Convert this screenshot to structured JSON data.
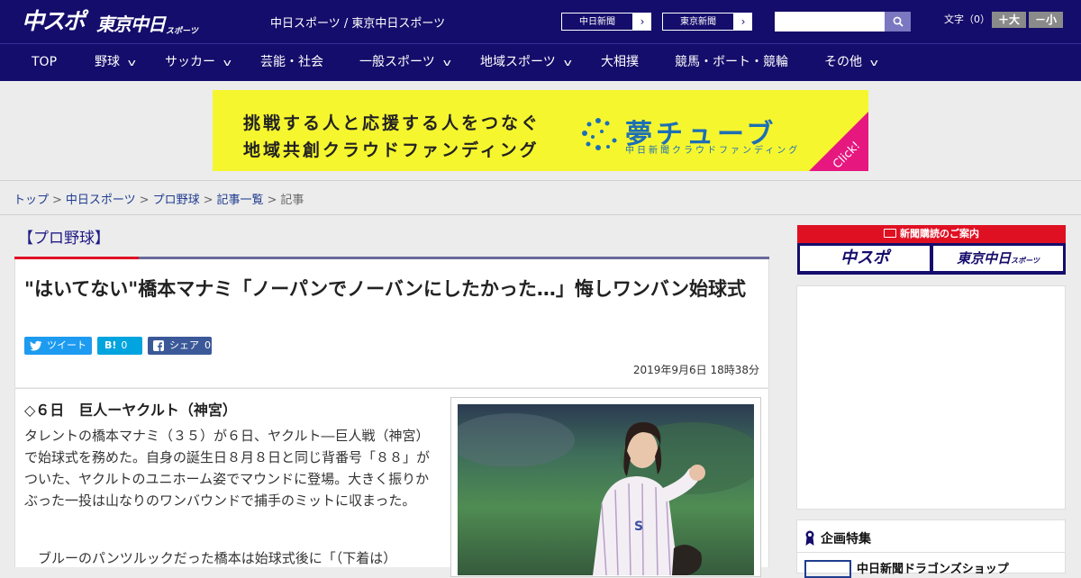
{
  "header": {
    "logo_chu": "中スポ",
    "logo_tokyo": "東京中日",
    "logo_sp": "スポーツ",
    "site_name": "中日スポーツ / 東京中日スポーツ",
    "paper_buttons": [
      {
        "label": "中日新聞",
        "arrow": "›"
      },
      {
        "label": "東京新聞",
        "arrow": "›"
      }
    ],
    "search_placeholder": "",
    "font_size_label": "文字（0）",
    "font_plus": "＋大",
    "font_minus": "－小"
  },
  "nav": {
    "items": [
      {
        "label": "TOP",
        "has_menu": false
      },
      {
        "label": "野球",
        "has_menu": true
      },
      {
        "label": "サッカー",
        "has_menu": true
      },
      {
        "label": "芸能・社会",
        "has_menu": false
      },
      {
        "label": "一般スポーツ",
        "has_menu": true
      },
      {
        "label": "地域スポーツ",
        "has_menu": true
      },
      {
        "label": "大相撲",
        "has_menu": false
      },
      {
        "label": "競馬・ボート・競輪",
        "has_menu": false
      },
      {
        "label": "その他",
        "has_menu": true
      }
    ]
  },
  "banner": {
    "line1": "挑戦する人と応援する人をつなぐ",
    "line2": "地域共創クラウドファンディング",
    "brand": "夢チューブ",
    "brand_sub": "中日新聞クラウドファンディング",
    "click": "Click!"
  },
  "breadcrumb": {
    "items": [
      "トップ",
      "中日スポーツ",
      "プロ野球",
      "記事一覧"
    ],
    "current": "記事",
    "separator": ">"
  },
  "article": {
    "category": "【プロ野球】",
    "title": "\"はいてない\"橋本マナミ「ノーパンでノーバンにしたかった…」悔しワンバン始球式",
    "share": {
      "tweet": "ツイート",
      "hatena_label": "B!",
      "hatena_count": "0",
      "fb_label": "シェア",
      "fb_count": "0"
    },
    "date": "2019年9月6日 18時38分",
    "subtitle": "◇６日　巨人ーヤクルト（神宮）",
    "paragraph1": "タレントの橋本マナミ（３５）が６日、ヤクルト―巨人戦（神宮）で始球式を務めた。自身の誕生日８月８日と同じ背番号「８８」がついた、ヤクルトのユニホーム姿でマウンドに登場。大きく振りかぶった一投は山なりのワンバウンドで捕手のミットに収まった。",
    "paragraph2": "ブルーのパンツルックだった橋本は始球式後に「（下着は）"
  },
  "sidebar": {
    "subscribe_head": "新聞購読のご案内",
    "subscribe_chu": "中スポ",
    "subscribe_tokyo": "東京中日",
    "subscribe_tokyo_sp": "スポーツ",
    "feature_head": "企画特集",
    "feature_item": "中日新聞ドラゴンズショップ"
  },
  "colors": {
    "navy": "#150d6b",
    "accent_red": "#e01023",
    "link": "#1f3c8f",
    "twitter": "#1d9bf0",
    "hatena": "#00a4de",
    "facebook": "#3b5998",
    "banner_yellow": "#f6f62f"
  }
}
